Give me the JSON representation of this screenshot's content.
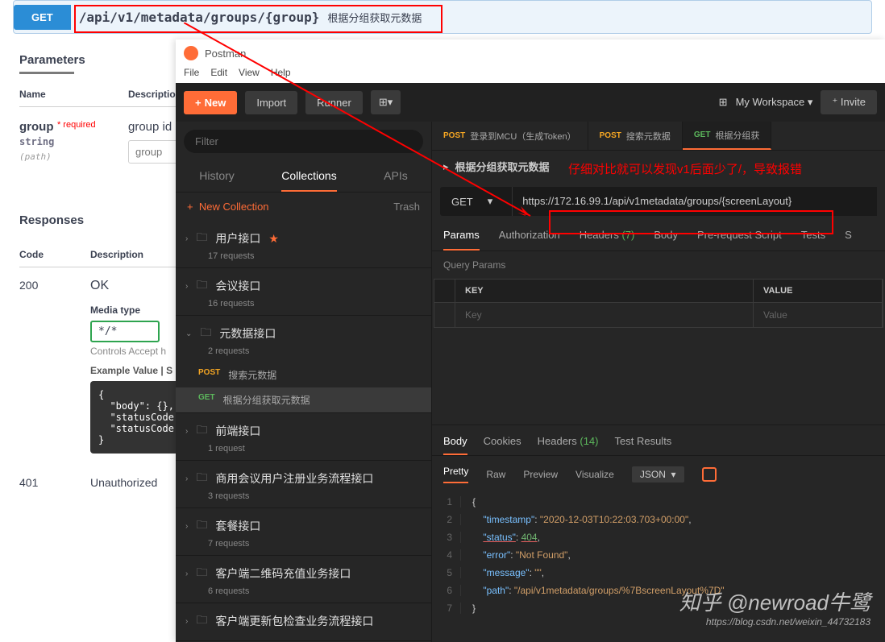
{
  "swagger": {
    "method": "GET",
    "path": "/api/v1/metadata/groups/{group}",
    "summary": "根据分组获取元数据",
    "sections": {
      "parameters": "Parameters",
      "responses": "Responses"
    },
    "thead": {
      "name": "Name",
      "desc": "Description"
    },
    "param": {
      "name": "group",
      "req": "* required",
      "type": "string",
      "in": "(path)",
      "desc": "group id",
      "placeholder": "group"
    },
    "resp": {
      "codeLabel": "Code",
      "descLabel": "Description",
      "r200": {
        "code": "200",
        "desc": "OK"
      },
      "r401": {
        "code": "401",
        "desc": "Unauthorized"
      },
      "mediaLabel": "Media type",
      "mediaVal": "*/*",
      "mediaHint": "Controls Accept h",
      "exampleTab": "Example Value | S",
      "exampleCode": "{\n  \"body\": {},\n  \"statusCode\n  \"statusCode\n}"
    }
  },
  "annotation": {
    "note": "仔细对比就可以发现v1后面少了/，导致报错"
  },
  "postman": {
    "title": "Postman",
    "menu": [
      "File",
      "Edit",
      "View",
      "Help"
    ],
    "toolbar": {
      "new": "New",
      "import": "Import",
      "runner": "Runner",
      "workspace": "My Workspace",
      "invite": "Invite"
    },
    "sidebar": {
      "filterPlaceholder": "Filter",
      "tabs": {
        "history": "History",
        "collections": "Collections",
        "apis": "APIs"
      },
      "newCollection": "New Collection",
      "trash": "Trash",
      "collections": [
        {
          "name": "用户接口",
          "count": "17 requests",
          "star": true
        },
        {
          "name": "会议接口",
          "count": "16 requests"
        },
        {
          "name": "元数据接口",
          "count": "2 requests",
          "open": true,
          "items": [
            {
              "method": "POST",
              "name": "搜索元数据"
            },
            {
              "method": "GET",
              "name": "根据分组获取元数据",
              "sel": true
            }
          ]
        },
        {
          "name": "前端接口",
          "count": "1 request"
        },
        {
          "name": "商用会议用户注册业务流程接口",
          "count": "3 requests"
        },
        {
          "name": "套餐接口",
          "count": "7 requests"
        },
        {
          "name": "客户端二维码充值业务接口",
          "count": "6 requests"
        },
        {
          "name": "客户端更新包检查业务流程接口",
          "count": ""
        }
      ]
    },
    "reqTabs": [
      {
        "method": "POST",
        "label": "登录到MCU（生成Token）"
      },
      {
        "method": "POST",
        "label": "搜索元数据"
      },
      {
        "method": "GET",
        "label": "根据分组获",
        "active": true
      }
    ],
    "breadcrumb": "根据分组获取元数据",
    "method": "GET",
    "url": "https://172.16.99.1/api/v1metadata/groups/{screenLayout}",
    "subtabs": {
      "params": "Params",
      "auth": "Authorization",
      "headers": "Headers",
      "headersCount": "(7)",
      "body": "Body",
      "prereq": "Pre-request Script",
      "tests": "Tests",
      "settings": "S"
    },
    "qp": {
      "label": "Query Params",
      "key": "KEY",
      "value": "VALUE",
      "keyPh": "Key",
      "valuePh": "Value"
    },
    "respTabs": {
      "body": "Body",
      "cookies": "Cookies",
      "headers": "Headers",
      "headersCount": "(14)",
      "tests": "Test Results"
    },
    "respSub": {
      "pretty": "Pretty",
      "raw": "Raw",
      "preview": "Preview",
      "visualize": "Visualize",
      "json": "JSON"
    },
    "response": {
      "lines": [
        {
          "n": 1,
          "raw": "{"
        },
        {
          "n": 2,
          "key": "timestamp",
          "val": "\"2020-12-03T10:22:03.703+00:00\"",
          "comma": true
        },
        {
          "n": 3,
          "key": "status",
          "num": "404",
          "comma": true,
          "underline": true
        },
        {
          "n": 4,
          "key": "error",
          "val": "\"Not Found\"",
          "comma": true
        },
        {
          "n": 5,
          "key": "message",
          "val": "\"\"",
          "comma": true
        },
        {
          "n": 6,
          "key": "path",
          "val": "\"/api/v1metadata/groups/%7BscreenLayout%7D\""
        },
        {
          "n": 7,
          "raw": "}"
        }
      ]
    }
  },
  "watermark": {
    "main": "知乎 @newroad牛鹭",
    "sub": "https://blog.csdn.net/weixin_44732183"
  }
}
